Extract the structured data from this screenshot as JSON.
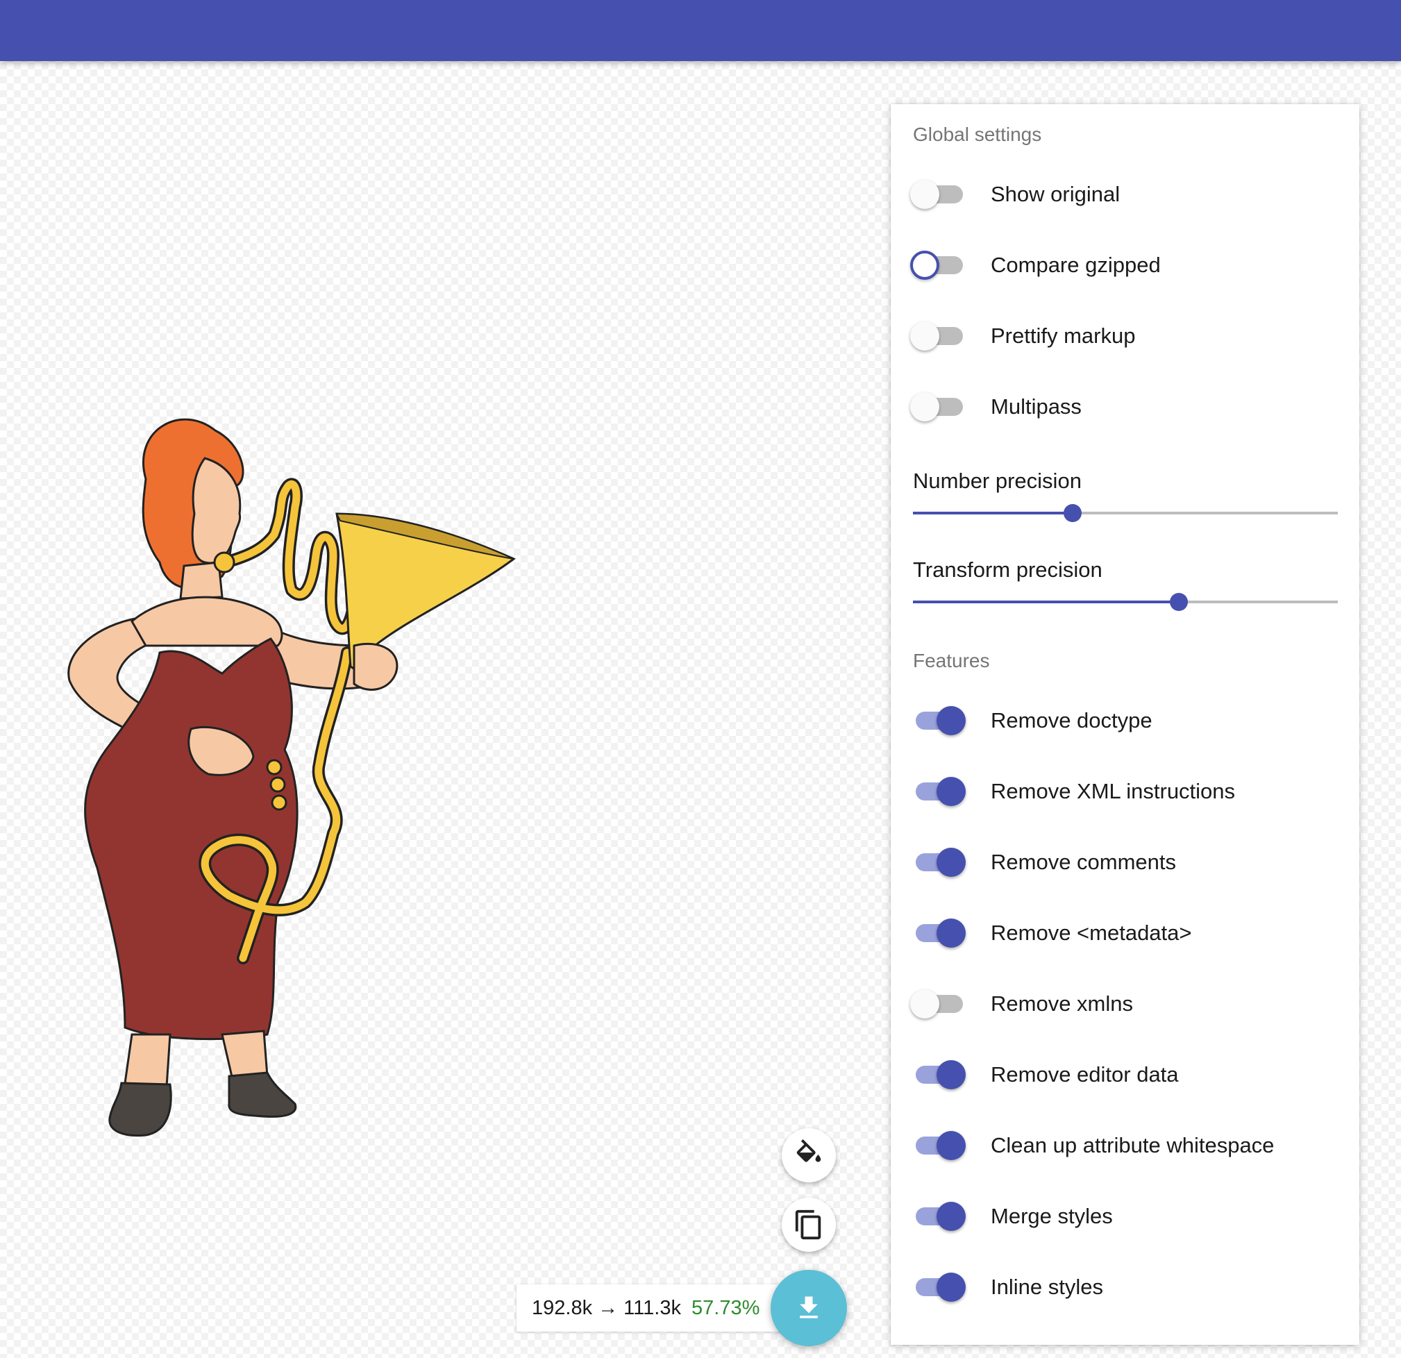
{
  "colors": {
    "accent": "#4650ae",
    "fab_download": "#5bbfd6",
    "success": "#2e8b2e"
  },
  "global_settings": {
    "heading": "Global settings",
    "toggles": [
      {
        "label": "Show original",
        "on": false
      },
      {
        "label": "Compare gzipped",
        "on": false,
        "focused": true
      },
      {
        "label": "Prettify markup",
        "on": false
      },
      {
        "label": "Multipass",
        "on": false
      }
    ],
    "sliders": [
      {
        "label": "Number precision",
        "value_fraction": 0.375
      },
      {
        "label": "Transform precision",
        "value_fraction": 0.625
      }
    ]
  },
  "features": {
    "heading": "Features",
    "toggles": [
      {
        "label": "Remove doctype",
        "on": true
      },
      {
        "label": "Remove XML instructions",
        "on": true
      },
      {
        "label": "Remove comments",
        "on": true
      },
      {
        "label": "Remove <metadata>",
        "on": true
      },
      {
        "label": "Remove xmlns",
        "on": false
      },
      {
        "label": "Remove editor data",
        "on": true
      },
      {
        "label": "Clean up attribute whitespace",
        "on": true
      },
      {
        "label": "Merge styles",
        "on": true
      },
      {
        "label": "Inline styles",
        "on": true
      }
    ]
  },
  "actions": {
    "buttons": [
      {
        "name": "paint-bucket-button",
        "icon": "paint-bucket-icon"
      },
      {
        "name": "copy-button",
        "icon": "copy-icon"
      },
      {
        "name": "download-button",
        "icon": "download-icon"
      }
    ]
  },
  "size_info": {
    "sizes": "192.8k → 111.3k",
    "percent": "57.73%"
  }
}
